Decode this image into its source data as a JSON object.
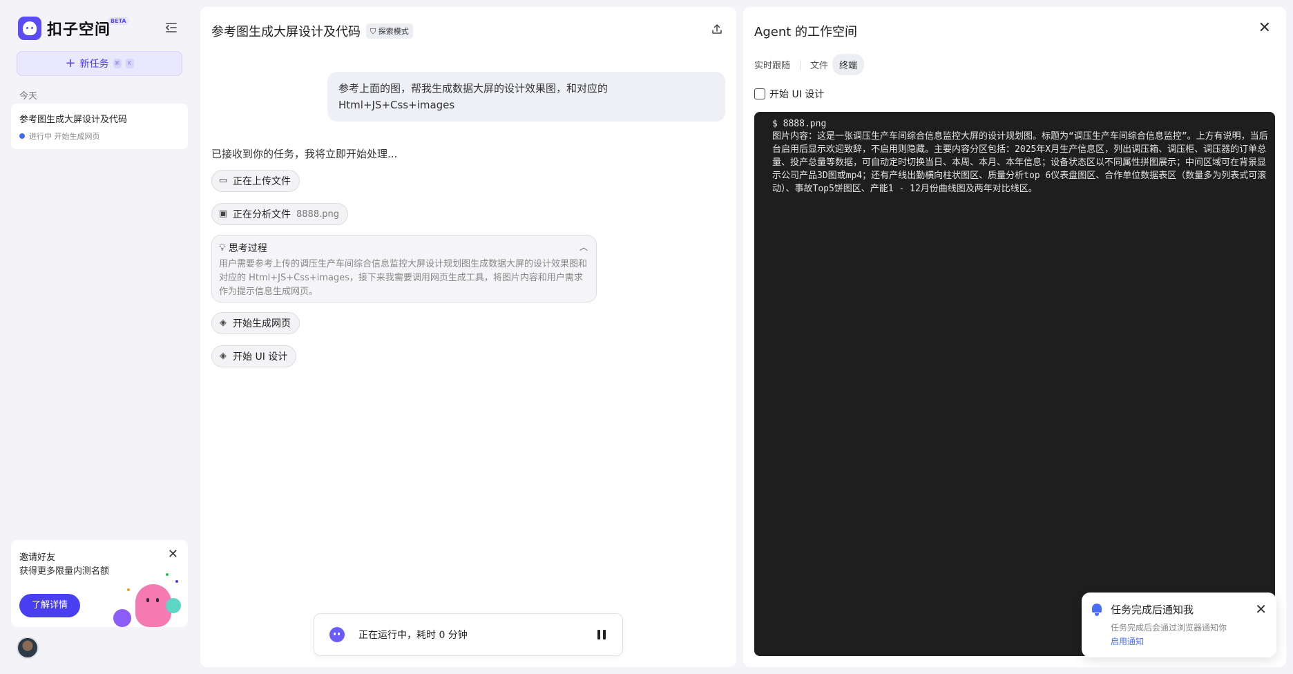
{
  "sidebar": {
    "brand_name": "扣子空间",
    "beta_label": "BETA",
    "new_task_label": "新任务",
    "shortcut_keys": [
      "⌘",
      "K"
    ],
    "section_today": "今天",
    "task": {
      "title": "参考图生成大屏设计及代码",
      "status": "进行中 开始生成网页"
    },
    "invite": {
      "title": "邀请好友",
      "subtitle": "获得更多限量内测名额",
      "button": "了解详情"
    }
  },
  "chat": {
    "title": "参考图生成大屏设计及代码",
    "mode_tag": "探索模式",
    "user_message": "参考上面的图，帮我生成数据大屏的设计效果图，和对应的Html+JS+Css+images",
    "ack": "已接收到你的任务，我将立即开始处理...",
    "steps": [
      {
        "label": "正在上传文件",
        "sub": ""
      },
      {
        "label": "正在分析文件",
        "sub": "8888.png"
      },
      {
        "label": "开始生成网页",
        "sub": ""
      },
      {
        "label": "开始 UI 设计",
        "sub": ""
      }
    ],
    "thinking": {
      "title": "思考过程",
      "body": "用户需要参考上传的调压生产车间综合信息监控大屏设计规划图生成数据大屏的设计效果图和对应的 Html+JS+Css+images，接下来我需要调用网页生成工具，将图片内容和用户需求作为提示信息生成网页。"
    },
    "run_status": "正在运行中，耗时 0 分钟"
  },
  "workspace": {
    "title": "Agent 的工作空间",
    "tabs": [
      "实时跟随",
      "文件",
      "终端"
    ],
    "active_tab": "终端",
    "step_label": "开始 UI 设计",
    "terminal": {
      "command": "$ 8888.png",
      "output": "图片内容：这是一张调压生产车间综合信息监控大屏的设计规划图。标题为“调压生产车间综合信息监控”。上方有说明，当后台启用后显示欢迎致辞，不启用则隐藏。主要内容分区包括：2025年X月生产信息区，列出调压箱、调压柜、调压器的订单总量、投产总量等数据，可自动定时切换当日、本周、本月、本年信息；设备状态区以不同属性拼图展示；中间区域可在背景显示公司产品3D图或mp4；还有产线出勤横向柱状图区、质量分析top 6仪表盘图区、合作单位数据表区（数量多为列表式可滚动）、事故Top5饼图区、产能1 - 12月份曲线图及两年对比线区。"
    }
  },
  "notification": {
    "title": "任务完成后通知我",
    "subtitle": "任务完成后会通过浏览器通知你",
    "link": "启用通知"
  },
  "colors": {
    "accent": "#4a3ff0",
    "terminal_bg": "#1e1e1e",
    "notify_blue": "#4a6cf7"
  }
}
